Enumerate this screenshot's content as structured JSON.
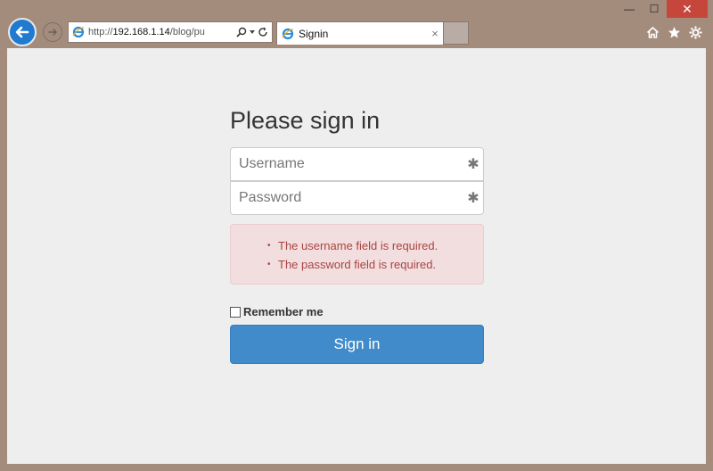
{
  "browser": {
    "address": {
      "prefix": "http://",
      "host": "192.168.1.14",
      "path": "/blog/pu"
    },
    "tab": {
      "title": "Signin",
      "close": "×"
    },
    "controls": {
      "minimize": "—",
      "restore": "☐",
      "close": "✕"
    }
  },
  "form": {
    "heading": "Please sign in",
    "username_placeholder": "Username",
    "password_placeholder": "Password",
    "required_marker": "✱",
    "errors": [
      "The username field is required.",
      "The password field is required."
    ],
    "remember_label": "Remember me",
    "submit_label": "Sign in"
  },
  "colors": {
    "primary": "#428bca",
    "error_text": "#a94442",
    "error_bg": "#f2dede",
    "ie_blue": "#1f7ad0"
  }
}
